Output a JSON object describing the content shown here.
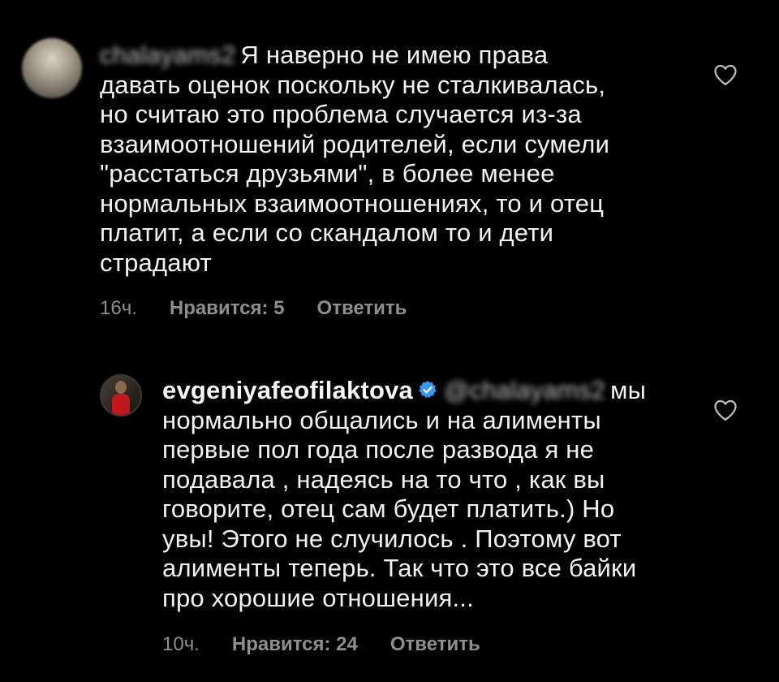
{
  "comments": [
    {
      "username": "chalayams2",
      "username_blurred": true,
      "mention": "",
      "lines": [
        "Я наверно не имею права",
        "давать оценок поскольку не сталкивалась,",
        "но считаю это проблема случается из-за",
        "взаимоотношений родителей, если сумели",
        "\"расстаться друзьями\", в более менее",
        "нормальных взаимоотношениях, то и отец",
        "платит, а если со скандалом то и дети",
        "страдают"
      ],
      "time": "16ч.",
      "likes": "Нравится: 5",
      "reply": "Ответить",
      "like_icon": "heart-outline-icon"
    },
    {
      "username": "evgeniyafeofilaktova",
      "verified": true,
      "mention": "@chalayams2",
      "mention_blurred": true,
      "first_line_rest": "мы",
      "lines": [
        "нормально общались и на алименты",
        "первые пол года после развода я не",
        "подавала , надеясь на то что , как вы",
        "говорите, отец сам будет платить.) Но",
        "увы! Этого не случилось . Поэтому вот",
        "алименты теперь. Так что это все байки",
        "про хорошие отношения..."
      ],
      "time": "10ч.",
      "likes": "Нравится: 24",
      "reply": "Ответить",
      "like_icon": "heart-outline-icon"
    }
  ],
  "colors": {
    "background": "#000000",
    "text": "#f2f2f2",
    "meta": "#8e8e8e",
    "verified_badge": "#3897f0"
  }
}
